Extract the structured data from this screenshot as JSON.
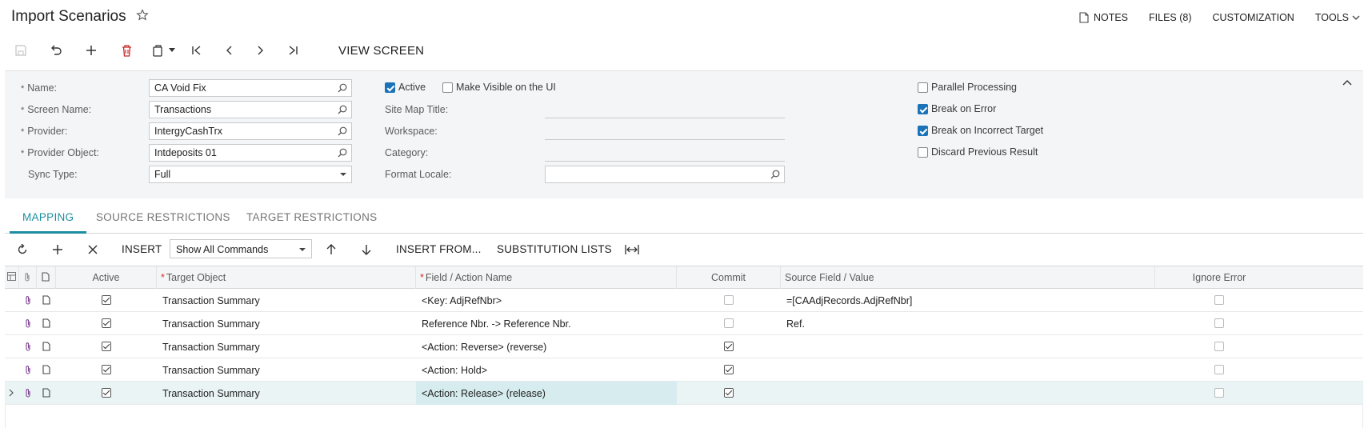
{
  "header": {
    "title": "Import Scenarios",
    "links": [
      {
        "label": "NOTES",
        "icon": "note-icon"
      },
      {
        "label": "FILES (8)"
      },
      {
        "label": "CUSTOMIZATION"
      },
      {
        "label": "TOOLS",
        "icon": "chevron-down-icon"
      }
    ]
  },
  "toolbar": {
    "view_screen_label": "VIEW SCREEN",
    "icons": [
      "save-icon",
      "undo-icon",
      "add-icon",
      "delete-icon",
      "clipboard-icon",
      "first-icon",
      "prev-icon",
      "next-icon",
      "last-icon"
    ]
  },
  "form": {
    "name": {
      "label": "Name:",
      "value": "CA Void Fix"
    },
    "screen_name": {
      "label": "Screen Name:",
      "value": "Transactions"
    },
    "provider": {
      "label": "Provider:",
      "value": "IntergyCashTrx"
    },
    "provider_object": {
      "label": "Provider Object:",
      "value": "Intdeposits 01"
    },
    "sync_type": {
      "label": "Sync Type:",
      "value": "Full"
    },
    "active": {
      "label": "Active",
      "checked": true
    },
    "make_visible": {
      "label": "Make Visible on the UI",
      "checked": false
    },
    "site_map_title": {
      "label": "Site Map Title:",
      "value": ""
    },
    "workspace": {
      "label": "Workspace:",
      "value": ""
    },
    "category": {
      "label": "Category:",
      "value": ""
    },
    "format_locale": {
      "label": "Format Locale:",
      "value": ""
    },
    "parallel_processing": {
      "label": "Parallel Processing",
      "checked": false
    },
    "break_on_error": {
      "label": "Break on Error",
      "checked": true
    },
    "break_on_incorrect_target": {
      "label": "Break on Incorrect Target",
      "checked": true
    },
    "discard_previous_result": {
      "label": "Discard Previous Result",
      "checked": false
    }
  },
  "tabs": [
    {
      "label": "MAPPING",
      "active": true
    },
    {
      "label": "SOURCE RESTRICTIONS",
      "active": false
    },
    {
      "label": "TARGET RESTRICTIONS",
      "active": false
    }
  ],
  "grid_toolbar": {
    "insert_label": "INSERT",
    "command_filter": "Show All Commands",
    "insert_from_label": "INSERT FROM...",
    "substitution_lists_label": "SUBSTITUTION LISTS"
  },
  "grid": {
    "columns": {
      "active": "Active",
      "target_object": "Target Object",
      "field_action": "Field / Action Name",
      "commit": "Commit",
      "source_field": "Source Field / Value",
      "ignore_error": "Ignore Error"
    },
    "rows": [
      {
        "active": true,
        "target_object": "Transaction Summary",
        "field_action": "<Key: AdjRefNbr>",
        "commit": false,
        "commit_disabled": true,
        "source_field": "=[CAAdjRecords.AdjRefNbr]",
        "ignore_error": false
      },
      {
        "active": true,
        "target_object": "Transaction Summary",
        "field_action": "Reference Nbr. -> Reference Nbr.",
        "commit": false,
        "commit_disabled": false,
        "source_field": "Ref.",
        "ignore_error": false
      },
      {
        "active": true,
        "target_object": "Transaction Summary",
        "field_action": "<Action: Reverse> (reverse)",
        "commit": true,
        "commit_disabled": false,
        "source_field": "",
        "ignore_error": false
      },
      {
        "active": true,
        "target_object": "Transaction Summary",
        "field_action": "<Action: Hold>",
        "commit": true,
        "commit_disabled": false,
        "source_field": "",
        "ignore_error": false
      },
      {
        "active": true,
        "target_object": "Transaction Summary",
        "field_action": "<Action: Release> (release)",
        "commit": true,
        "commit_disabled": false,
        "source_field": "",
        "ignore_error": false,
        "selected": true
      }
    ]
  },
  "colors": {
    "accent": "#1d8ea0",
    "checkbox": "#1a73b8",
    "danger": "#d32f2f",
    "selected_row": "#eaf4f5"
  }
}
